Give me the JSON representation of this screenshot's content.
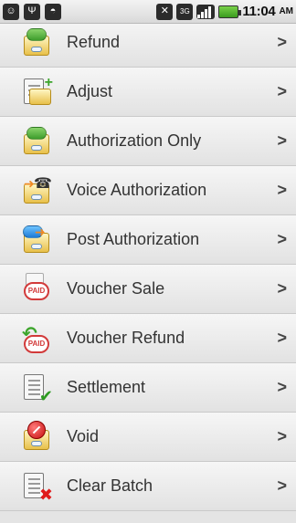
{
  "status_bar": {
    "time": "11:04",
    "ampm": "AM",
    "icons": [
      "bbm-icon",
      "usb-icon",
      "android-icon",
      "mute-icon",
      "3g-icon",
      "signal-icon",
      "battery-icon"
    ]
  },
  "menu": {
    "items": [
      {
        "label": "Refund",
        "icon": "refund-card-icon"
      },
      {
        "label": "Adjust",
        "icon": "adjust-icon"
      },
      {
        "label": "Authorization Only",
        "icon": "authorization-card-icon"
      },
      {
        "label": "Voice Authorization",
        "icon": "voice-authorization-icon"
      },
      {
        "label": "Post Authorization",
        "icon": "post-authorization-icon"
      },
      {
        "label": "Voucher Sale",
        "icon": "paid-voucher-icon"
      },
      {
        "label": "Voucher Refund",
        "icon": "voucher-refund-icon"
      },
      {
        "label": "Settlement",
        "icon": "settlement-icon"
      },
      {
        "label": "Void",
        "icon": "void-icon"
      },
      {
        "label": "Clear Batch",
        "icon": "clear-batch-icon"
      }
    ],
    "chevron": ">"
  }
}
